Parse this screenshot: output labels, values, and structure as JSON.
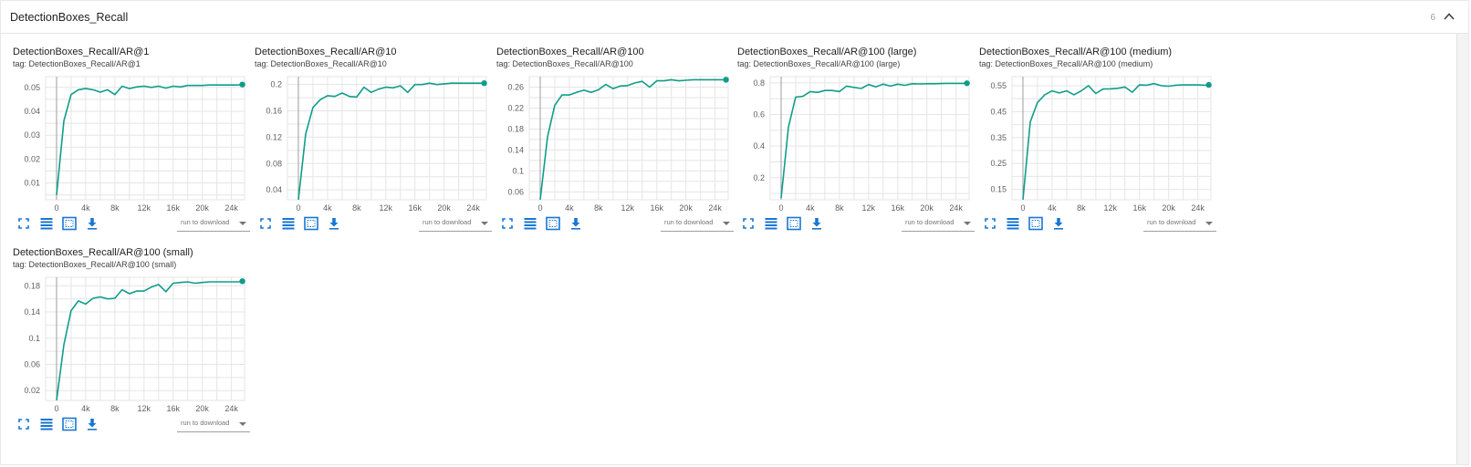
{
  "section": {
    "title": "DetectionBoxes_Recall",
    "count": "6"
  },
  "colors": {
    "series": "#0f9d8a",
    "grid": "#e5e5e5",
    "icon": "#1976d2"
  },
  "icons": {
    "collapse": "chevron-up-icon",
    "fullscreen": "fullscreen-icon",
    "toggle_log": "lines-icon",
    "fit_domain": "fit-domain-icon",
    "download": "download-icon"
  },
  "cards": [
    {
      "title": "DetectionBoxes_Recall/AR@1",
      "tag": "tag: DetectionBoxes_Recall/AR@1",
      "download_label": "run to download"
    },
    {
      "title": "DetectionBoxes_Recall/AR@10",
      "tag": "tag: DetectionBoxes_Recall/AR@10",
      "download_label": "run to download"
    },
    {
      "title": "DetectionBoxes_Recall/AR@100",
      "tag": "tag: DetectionBoxes_Recall/AR@100",
      "download_label": "run to download"
    },
    {
      "title": "DetectionBoxes_Recall/AR@100 (large)",
      "tag": "tag: DetectionBoxes_Recall/AR@100 (large)",
      "download_label": "run to download"
    },
    {
      "title": "DetectionBoxes_Recall/AR@100 (medium)",
      "tag": "tag: DetectionBoxes_Recall/AR@100 (medium)",
      "download_label": "run to download"
    },
    {
      "title": "DetectionBoxes_Recall/AR@100 (small)",
      "tag": "tag: DetectionBoxes_Recall/AR@100 (small)",
      "download_label": "run to download"
    }
  ],
  "chart_data": [
    {
      "type": "line",
      "xlim": [
        -1500,
        25800
      ],
      "ylim": [
        0.003,
        0.0545
      ],
      "xticks": [
        0,
        4000,
        8000,
        12000,
        16000,
        20000,
        24000
      ],
      "xtick_labels": [
        "0",
        "4k",
        "8k",
        "12k",
        "16k",
        "20k",
        "24k"
      ],
      "yticks": [
        0.01,
        0.02,
        0.03,
        0.04,
        0.05
      ],
      "ytick_labels": [
        "0.01",
        "0.02",
        "0.03",
        "0.04",
        "0.05"
      ],
      "x": [
        0,
        1000,
        2000,
        3000,
        4000,
        5000,
        6000,
        7000,
        8000,
        9000,
        10000,
        11000,
        12000,
        13000,
        14000,
        15000,
        16000,
        17000,
        18000,
        19000,
        20000,
        21000,
        22000,
        23000,
        24000,
        25000,
        25500
      ],
      "y": [
        0.005,
        0.036,
        0.047,
        0.049,
        0.0495,
        0.049,
        0.048,
        0.049,
        0.047,
        0.0505,
        0.0495,
        0.0502,
        0.0505,
        0.05,
        0.0505,
        0.0497,
        0.0505,
        0.0502,
        0.0508,
        0.0508,
        0.0508,
        0.051,
        0.051,
        0.051,
        0.051,
        0.051,
        0.0512
      ]
    },
    {
      "type": "line",
      "xlim": [
        -1500,
        25800
      ],
      "ylim": [
        0.025,
        0.212
      ],
      "xticks": [
        0,
        4000,
        8000,
        12000,
        16000,
        20000,
        24000
      ],
      "xtick_labels": [
        "0",
        "4k",
        "8k",
        "12k",
        "16k",
        "20k",
        "24k"
      ],
      "yticks": [
        0.04,
        0.08,
        0.12,
        0.16,
        0.2
      ],
      "ytick_labels": [
        "0.04",
        "0.08",
        "0.12",
        "0.16",
        "0.2"
      ],
      "x": [
        0,
        1000,
        2000,
        3000,
        4000,
        5000,
        6000,
        7000,
        8000,
        9000,
        10000,
        11000,
        12000,
        13000,
        14000,
        15000,
        16000,
        17000,
        18000,
        19000,
        20000,
        21000,
        22000,
        23000,
        24000,
        25000,
        25500
      ],
      "y": [
        0.025,
        0.125,
        0.165,
        0.177,
        0.183,
        0.182,
        0.187,
        0.182,
        0.181,
        0.196,
        0.188,
        0.193,
        0.196,
        0.195,
        0.198,
        0.188,
        0.2,
        0.2,
        0.202,
        0.2,
        0.201,
        0.202,
        0.202,
        0.202,
        0.202,
        0.202,
        0.202
      ]
    },
    {
      "type": "line",
      "xlim": [
        -1500,
        25800
      ],
      "ylim": [
        0.045,
        0.28
      ],
      "xticks": [
        0,
        4000,
        8000,
        12000,
        16000,
        20000,
        24000
      ],
      "xtick_labels": [
        "0",
        "4k",
        "8k",
        "12k",
        "16k",
        "20k",
        "24k"
      ],
      "yticks": [
        0.06,
        0.1,
        0.14,
        0.18,
        0.22,
        0.26
      ],
      "ytick_labels": [
        "0.06",
        "0.1",
        "0.14",
        "0.18",
        "0.22",
        "0.26"
      ],
      "x": [
        0,
        1000,
        2000,
        3000,
        4000,
        5000,
        6000,
        7000,
        8000,
        9000,
        10000,
        11000,
        12000,
        13000,
        14000,
        15000,
        16000,
        17000,
        18000,
        19000,
        20000,
        21000,
        22000,
        23000,
        24000,
        25000,
        25500
      ],
      "y": [
        0.045,
        0.165,
        0.225,
        0.245,
        0.245,
        0.25,
        0.254,
        0.25,
        0.255,
        0.265,
        0.257,
        0.262,
        0.263,
        0.268,
        0.271,
        0.26,
        0.272,
        0.272,
        0.274,
        0.272,
        0.273,
        0.274,
        0.274,
        0.274,
        0.274,
        0.274,
        0.274
      ]
    },
    {
      "type": "line",
      "xlim": [
        -1500,
        25800
      ],
      "ylim": [
        0.06,
        0.84
      ],
      "xticks": [
        0,
        4000,
        8000,
        12000,
        16000,
        20000,
        24000
      ],
      "xtick_labels": [
        "0",
        "4k",
        "8k",
        "12k",
        "16k",
        "20k",
        "24k"
      ],
      "yticks": [
        0.2,
        0.4,
        0.6,
        0.8
      ],
      "ytick_labels": [
        "0.2",
        "0.4",
        "0.6",
        "0.8"
      ],
      "x": [
        0,
        1000,
        2000,
        3000,
        4000,
        5000,
        6000,
        7000,
        8000,
        9000,
        10000,
        11000,
        12000,
        13000,
        14000,
        15000,
        16000,
        17000,
        18000,
        19000,
        20000,
        21000,
        22000,
        23000,
        24000,
        25000,
        25500
      ],
      "y": [
        0.07,
        0.52,
        0.71,
        0.715,
        0.745,
        0.74,
        0.752,
        0.752,
        0.745,
        0.78,
        0.772,
        0.765,
        0.79,
        0.775,
        0.792,
        0.78,
        0.792,
        0.785,
        0.795,
        0.794,
        0.795,
        0.795,
        0.796,
        0.797,
        0.797,
        0.797,
        0.798
      ]
    },
    {
      "type": "line",
      "xlim": [
        -1500,
        25800
      ],
      "ylim": [
        0.11,
        0.585
      ],
      "xticks": [
        0,
        4000,
        8000,
        12000,
        16000,
        20000,
        24000
      ],
      "xtick_labels": [
        "0",
        "4k",
        "8k",
        "12k",
        "16k",
        "20k",
        "24k"
      ],
      "yticks": [
        0.15,
        0.25,
        0.35,
        0.45,
        0.55
      ],
      "ytick_labels": [
        "0.15",
        "0.25",
        "0.35",
        "0.45",
        "0.55"
      ],
      "x": [
        0,
        1000,
        2000,
        3000,
        4000,
        5000,
        6000,
        7000,
        8000,
        9000,
        10000,
        11000,
        12000,
        13000,
        14000,
        15000,
        16000,
        17000,
        18000,
        19000,
        20000,
        21000,
        22000,
        23000,
        24000,
        25000,
        25500
      ],
      "y": [
        0.11,
        0.41,
        0.485,
        0.515,
        0.53,
        0.522,
        0.53,
        0.515,
        0.53,
        0.55,
        0.52,
        0.537,
        0.538,
        0.54,
        0.545,
        0.525,
        0.553,
        0.552,
        0.558,
        0.55,
        0.548,
        0.552,
        0.553,
        0.553,
        0.553,
        0.552,
        0.553
      ]
    },
    {
      "type": "line",
      "xlim": [
        -1500,
        25800
      ],
      "ylim": [
        0.005,
        0.193
      ],
      "xticks": [
        0,
        4000,
        8000,
        12000,
        16000,
        20000,
        24000
      ],
      "xtick_labels": [
        "0",
        "4k",
        "8k",
        "12k",
        "16k",
        "20k",
        "24k"
      ],
      "yticks": [
        0.02,
        0.06,
        0.1,
        0.14,
        0.18
      ],
      "ytick_labels": [
        "0.02",
        "0.06",
        "0.1",
        "0.14",
        "0.18"
      ],
      "x": [
        0,
        1000,
        2000,
        3000,
        4000,
        5000,
        6000,
        7000,
        8000,
        9000,
        10000,
        11000,
        12000,
        13000,
        14000,
        15000,
        16000,
        17000,
        18000,
        19000,
        20000,
        21000,
        22000,
        23000,
        24000,
        25000,
        25500
      ],
      "y": [
        0.005,
        0.09,
        0.142,
        0.157,
        0.152,
        0.161,
        0.163,
        0.16,
        0.161,
        0.174,
        0.168,
        0.172,
        0.172,
        0.178,
        0.182,
        0.171,
        0.184,
        0.185,
        0.186,
        0.184,
        0.185,
        0.186,
        0.186,
        0.186,
        0.186,
        0.186,
        0.187
      ]
    }
  ]
}
